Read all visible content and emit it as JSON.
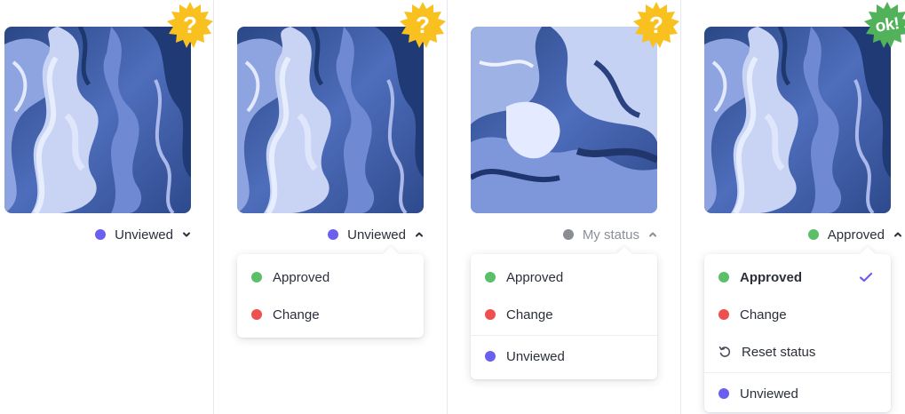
{
  "colors": {
    "approved": "#5bbf6a",
    "change": "#ee4f4f",
    "unviewed": "#6b5ff0",
    "my_status": "#8a8d93",
    "badge_question": "#f8c11f",
    "badge_ok": "#52b25a",
    "check": "#6b5ff0"
  },
  "cards": [
    {
      "badge": {
        "text": "?",
        "icon": "starburst-question-badge"
      },
      "status": {
        "label": "Unviewed",
        "dot": "unviewed",
        "chevron": "chevron-down-icon"
      }
    },
    {
      "badge": {
        "text": "?",
        "icon": "starburst-question-badge"
      },
      "status": {
        "label": "Unviewed",
        "dot": "unviewed",
        "chevron": "chevron-up-icon"
      },
      "menu": [
        {
          "label": "Approved",
          "dot": "approved"
        },
        {
          "label": "Change",
          "dot": "change"
        }
      ]
    },
    {
      "badge": {
        "text": "?",
        "icon": "starburst-question-badge"
      },
      "status": {
        "label": "My status",
        "dot": "my_status",
        "chevron": "chevron-up-icon"
      },
      "menu": [
        {
          "label": "Approved",
          "dot": "approved"
        },
        {
          "label": "Change",
          "dot": "change"
        },
        {
          "label": "Unviewed",
          "dot": "unviewed"
        }
      ]
    },
    {
      "badge": {
        "text": "ok!",
        "icon": "starburst-ok-badge"
      },
      "status": {
        "label": "Approved",
        "dot": "approved",
        "chevron": "chevron-up-icon"
      },
      "menu": [
        {
          "label": "Approved",
          "dot": "approved",
          "selected": true,
          "icon": "checkmark-icon"
        },
        {
          "label": "Change",
          "dot": "change"
        },
        {
          "label": "Reset status",
          "icon": "reset-icon"
        },
        {
          "label": "Unviewed",
          "dot": "unviewed"
        }
      ]
    }
  ]
}
